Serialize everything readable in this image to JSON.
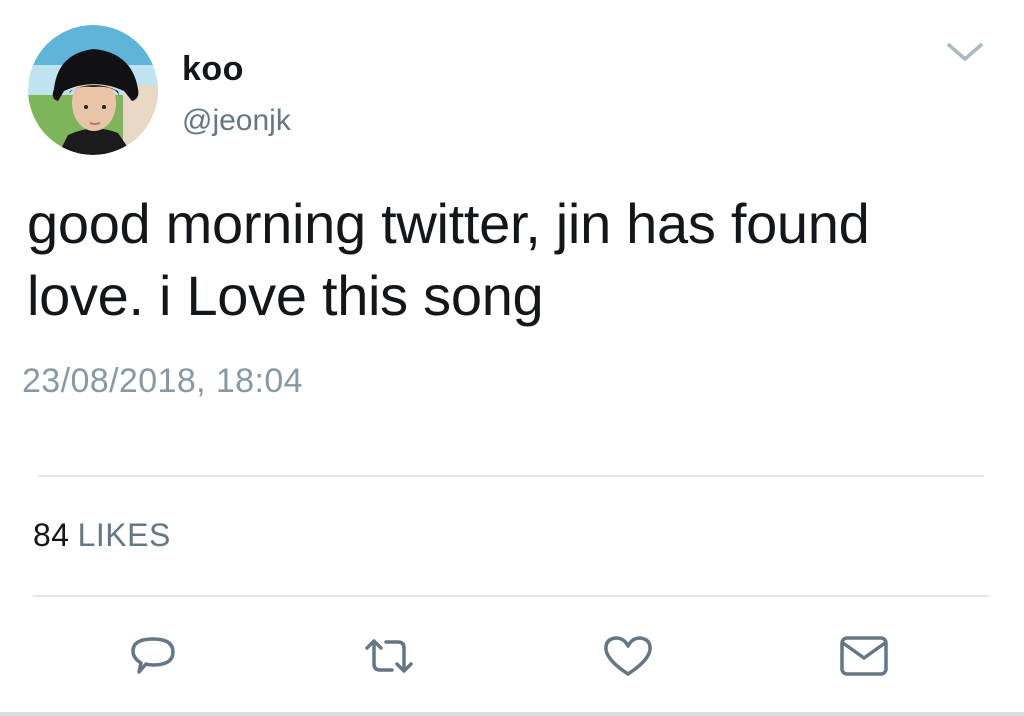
{
  "user": {
    "display_name": "koo",
    "handle": "@jeonjk"
  },
  "tweet": {
    "text": "good morning twitter, jin has found love. i Love this song",
    "timestamp": "23/08/2018, 18:04"
  },
  "stats": {
    "likes_count": "84",
    "likes_label": "LIKES"
  },
  "actions": {
    "reply_icon": "reply-icon",
    "retweet_icon": "retweet-icon",
    "like_icon": "heart-icon",
    "dm_icon": "envelope-icon"
  },
  "colors": {
    "text_primary": "#14171a",
    "text_secondary": "#657786",
    "timestamp": "#8899a6",
    "icon": "#657786",
    "divider": "#e1e8ed"
  }
}
